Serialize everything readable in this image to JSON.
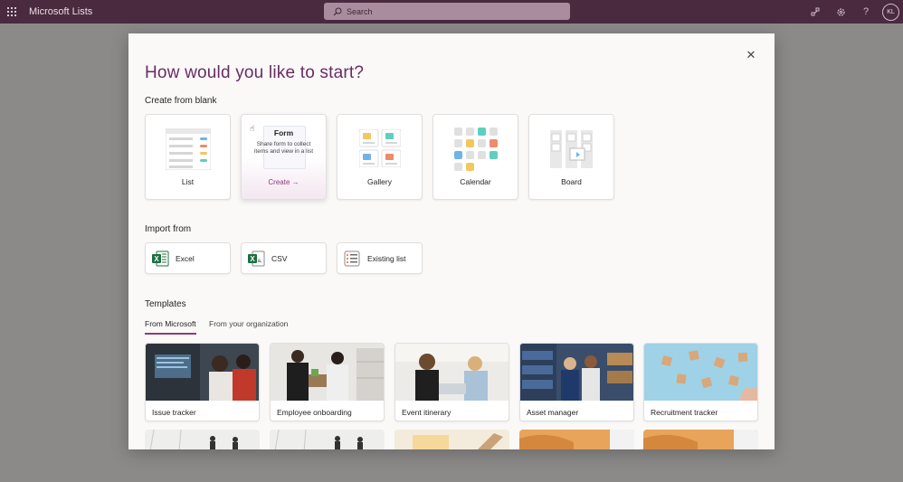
{
  "app": {
    "name": "Microsoft Lists",
    "avatar_initials": "KL"
  },
  "search": {
    "placeholder": "Search"
  },
  "icons": {
    "waffle": "waffle-icon",
    "search": "search-icon",
    "share": "share-network-icon",
    "settings": "gear-icon",
    "help": "help-icon",
    "close": "close-icon"
  },
  "modal": {
    "title": "How would you like to start?",
    "close_glyph": "✕",
    "blank": {
      "title": "Create from blank",
      "cards": [
        {
          "label": "List"
        },
        {
          "label": "Form",
          "description": "Share form to collect items and view in a list",
          "action": "Create →"
        },
        {
          "label": "Gallery"
        },
        {
          "label": "Calendar"
        },
        {
          "label": "Board"
        }
      ]
    },
    "import": {
      "title": "Import from",
      "items": [
        {
          "label": "Excel"
        },
        {
          "label": "CSV"
        },
        {
          "label": "Existing list"
        }
      ]
    },
    "templates": {
      "title": "Templates",
      "tabs": [
        {
          "label": "From Microsoft",
          "active": true
        },
        {
          "label": "From your organization",
          "active": false
        }
      ],
      "items": [
        {
          "label": "Issue tracker"
        },
        {
          "label": "Employee onboarding"
        },
        {
          "label": "Event itinerary"
        },
        {
          "label": "Asset manager"
        },
        {
          "label": "Recruitment tracker"
        }
      ]
    }
  },
  "colors": {
    "topbar": "#4a2a3f",
    "accent": "#8e3a80",
    "title": "#6a2b63",
    "overlay": "#8c8a89"
  }
}
